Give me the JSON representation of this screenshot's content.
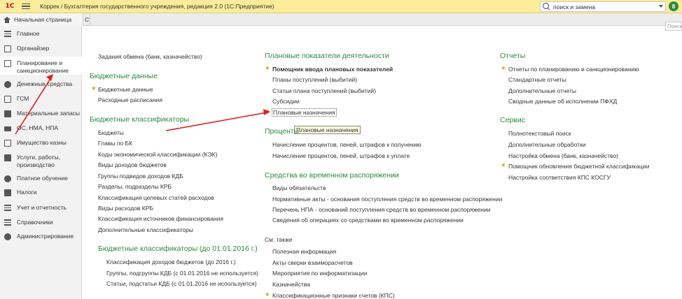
{
  "window": {
    "title": "Коррек / Бухгалтерия государственного учреждения, редакция 2.0  (1С:Предприятие)",
    "logo_text": "1С",
    "search_value": "поиск и замена",
    "notifications_count": "8"
  },
  "tabs": {
    "home_label": "Начальная страница",
    "next_label": "Ст"
  },
  "main_search_placeholder": "Поиск",
  "sidebar": {
    "items": [
      {
        "label": "Главное",
        "icon": "lines-icon"
      },
      {
        "label": "Органайзер",
        "icon": "organizer-icon"
      },
      {
        "label": "Планирование и санкционирование",
        "icon": "planning-icon",
        "active": true
      },
      {
        "label": "Денежные средства",
        "icon": "money-icon"
      },
      {
        "label": "ГСМ",
        "icon": "fuel-icon"
      },
      {
        "label": "Материальные запасы",
        "icon": "materials-icon"
      },
      {
        "label": "ОС, НМА, НПА",
        "icon": "truck-icon"
      },
      {
        "label": "Имущество казны",
        "icon": "treasury-icon"
      },
      {
        "label": "Услуги, работы, производство",
        "icon": "services-icon"
      },
      {
        "label": "Платное обучение",
        "icon": "education-icon"
      },
      {
        "label": "Налоги",
        "icon": "taxes-icon"
      },
      {
        "label": "Учет и отчетность",
        "icon": "accounting-icon"
      },
      {
        "label": "Справочники",
        "icon": "catalogs-icon"
      },
      {
        "label": "Администрирование",
        "icon": "gear-icon"
      }
    ]
  },
  "col1": {
    "top_link": "Задания обмена (банк, казначейство)",
    "section1_title": "Бюджетные данные",
    "section1_links": [
      "Бюджетные данные",
      "Расходные расписания"
    ],
    "section2_title": "Бюджетные классификаторы",
    "section2_links": [
      "Бюджеты",
      "Главы по БК",
      "Коды экономической классификации (КЭК)",
      "Виды доходов бюджетов",
      "Группы подвидов доходов КДБ",
      "Разделы, подразделы КРБ",
      "Классификация целевых статей расходов",
      "Виды расходов КРБ",
      "Классификация источников финансирования",
      "Дополнительные классификаторы"
    ],
    "section3_title": "Бюджетные классификаторы (до 01.01.2016 г.)",
    "section3_links": [
      "Классификация доходов бюджетов (до 2016 г.)",
      "Группы, подгруппы КДБ (с 01.01.2016 не используется)",
      "Статьи, подстатьи КДБ (с 01.01.2016 не используется)"
    ]
  },
  "col2": {
    "section1_title": "Плановые показатели деятельности",
    "section1_links": [
      "Помощник ввода плановых показателей",
      "Планы поступлений (выбитий)",
      "Статьи плана поступлений (выбитий)",
      "Субсидии",
      "Плановые назначения"
    ],
    "tooltip": "Плановые назначения",
    "section2_title": "Проценты",
    "section2_links": [
      "Начисление процентов, пеней, штрафов к получению",
      "Начисление процентов, пеней, штрафов к уплате"
    ],
    "section3_title": "Средства во временном распоряжении",
    "section3_links": [
      "Виды обязательств",
      "Нормативные акты - основания  поступления средств во временном распоряжении",
      "Перечень НПА - оснований поступления средств во временном распоряжении",
      "Сведения об операциях со средствами во временном распоряжении"
    ],
    "see_also_title": "См. также",
    "see_also_links": [
      "Полезная информация",
      "Акты сверки взаиморасчетов",
      "Мероприятия по информатизации",
      "Казначейства",
      "Классификационные признаки счетов (КПС)"
    ]
  },
  "col3": {
    "section1_title": "Отчеты",
    "section1_links": [
      "Отчеты по планированию и санкционированию",
      "Стандартные отчеты",
      "Дополнительные отчеты",
      "Сводные данные об исполнении ПФХД"
    ],
    "section2_title": "Сервис",
    "section2_links": [
      "Полнотекстовый поиск",
      "Дополнительные обработки",
      "Настройка обмена (банк, казначейство)",
      "Помощник обновления бюджетной классификации",
      "Настройка соответствия КПС КОСГУ"
    ]
  },
  "colors": {
    "title_bar": "#fbec9a",
    "section_heading": "#2c8a3a",
    "favorite_star": "#e8a317",
    "annotation_arrow": "#e0201e"
  }
}
